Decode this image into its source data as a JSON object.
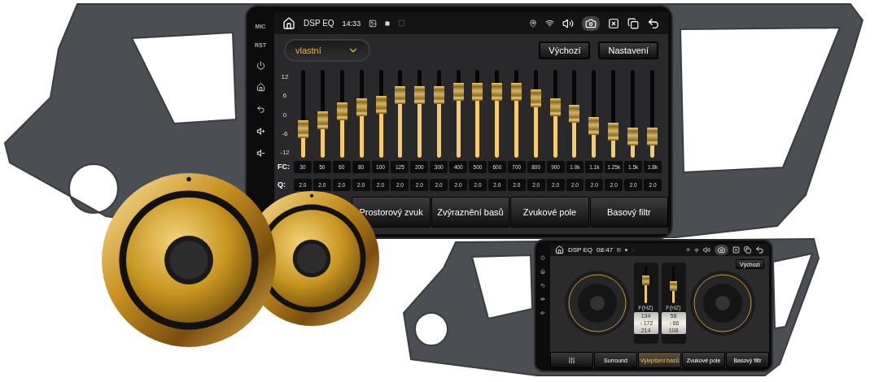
{
  "main_screen": {
    "side_labels": [
      "MIC",
      "RST"
    ],
    "status_bar": {
      "title": "DSP EQ",
      "time": "14:33"
    },
    "preset": {
      "value": "vlastní"
    },
    "buttons": [
      "Výchozí",
      "Nastavení"
    ],
    "eq": {
      "scale": [
        "12",
        "6",
        "0",
        "-6",
        "-12"
      ],
      "fc_label": "FC:",
      "q_label": "Q:",
      "bands": [
        {
          "fc": "30",
          "q": "2.0",
          "level": 0.28
        },
        {
          "fc": "50",
          "q": "2.0",
          "level": 0.41
        },
        {
          "fc": "60",
          "q": "2.0",
          "level": 0.54
        },
        {
          "fc": "80",
          "q": "2.0",
          "level": 0.59
        },
        {
          "fc": "100",
          "q": "2.0",
          "level": 0.63
        },
        {
          "fc": "125",
          "q": "2.0",
          "level": 0.77
        },
        {
          "fc": "200",
          "q": "2.0",
          "level": 0.77
        },
        {
          "fc": "300",
          "q": "2.0",
          "level": 0.77
        },
        {
          "fc": "400",
          "q": "2.0",
          "level": 0.81
        },
        {
          "fc": "500",
          "q": "2.0",
          "level": 0.81
        },
        {
          "fc": "600",
          "q": "2.0",
          "level": 0.81
        },
        {
          "fc": "700",
          "q": "2.0",
          "level": 0.81
        },
        {
          "fc": "800",
          "q": "2.0",
          "level": 0.72
        },
        {
          "fc": "900",
          "q": "2.0",
          "level": 0.59
        },
        {
          "fc": "1.0k",
          "q": "2.0",
          "level": 0.5
        },
        {
          "fc": "1.1k",
          "q": "2.0",
          "level": 0.33
        },
        {
          "fc": "1.25k",
          "q": "2.0",
          "level": 0.24
        },
        {
          "fc": "1.5k",
          "q": "2.0",
          "level": 0.18
        },
        {
          "fc": "1.8k",
          "q": "2.0",
          "level": 0.18
        }
      ]
    },
    "tabs": [
      {
        "label": "Prostorový zvuk",
        "selected": false
      },
      {
        "label": "Zvýraznění basů",
        "selected": false
      },
      {
        "label": "Zvukové pole",
        "selected": false
      },
      {
        "label": "Basový filtr",
        "selected": false
      }
    ]
  },
  "inset_screen": {
    "status_bar": {
      "title": "DSP EQ",
      "time": "08:47"
    },
    "button": "Výchozí",
    "channels": [
      {
        "label": "F(HZ)",
        "values": [
          "134",
          "172",
          "214"
        ],
        "level": 0.66
      },
      {
        "label": "F(HZ)",
        "values": [
          "58",
          "86",
          "108"
        ],
        "level": 0.45
      }
    ],
    "tabs": [
      {
        "kind": "icon",
        "selected": false
      },
      {
        "kind": "text",
        "label": "Surround",
        "selected": false
      },
      {
        "kind": "text",
        "label": "Vylepšení basů",
        "selected": true
      },
      {
        "kind": "text",
        "label": "Zvukové pole",
        "selected": false
      },
      {
        "kind": "text",
        "label": "Basový filtr",
        "selected": false
      }
    ]
  }
}
